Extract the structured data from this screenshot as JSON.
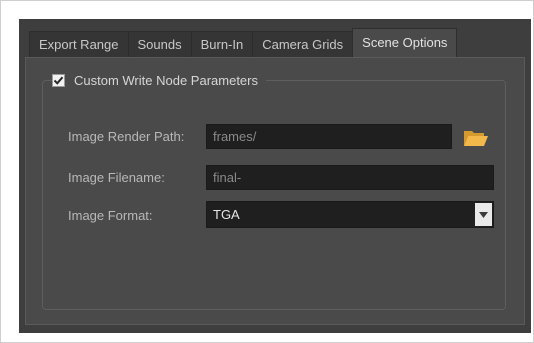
{
  "tabs": [
    {
      "label": "Export Range",
      "active": false
    },
    {
      "label": "Sounds",
      "active": false
    },
    {
      "label": "Burn-In",
      "active": false
    },
    {
      "label": "Camera Grids",
      "active": false
    },
    {
      "label": "Scene Options",
      "active": true
    }
  ],
  "group": {
    "title": "Custom Write Node Parameters",
    "checked": true
  },
  "fields": {
    "render_path": {
      "label": "Image Render Path:",
      "placeholder": "frames/",
      "icon": "folder-open-icon"
    },
    "filename": {
      "label": "Image Filename:",
      "placeholder": "final-"
    },
    "format": {
      "label": "Image Format:",
      "value": "TGA",
      "icon": "chevron-down-icon"
    }
  },
  "colors": {
    "panel_bg": "#3e3e3e",
    "tab_body_bg": "#4a4a4a",
    "field_bg": "#1f1f1f",
    "folder_icon": "#f2b94a"
  }
}
